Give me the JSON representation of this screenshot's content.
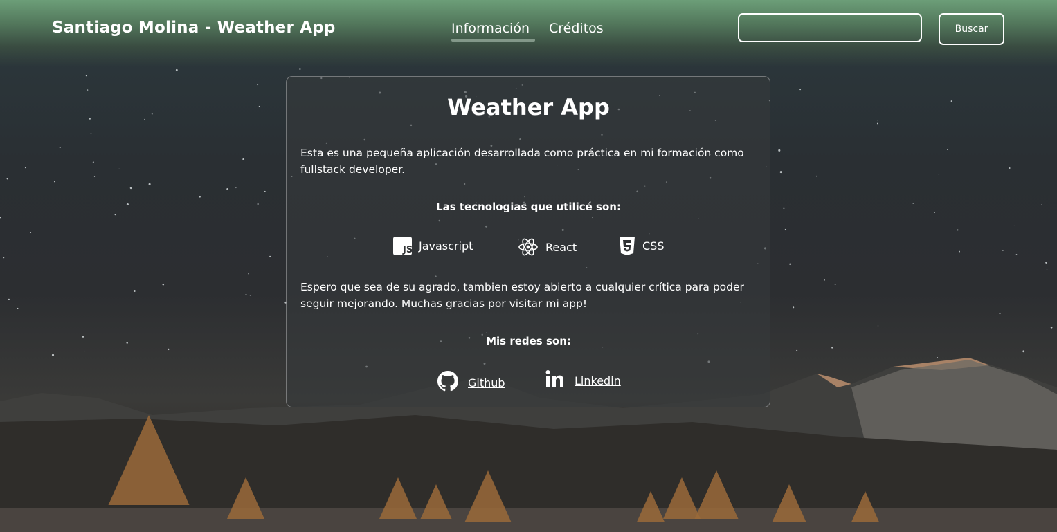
{
  "header": {
    "brand": "Santiago Molina - Weather App",
    "nav": [
      {
        "label": "Información"
      },
      {
        "label": "Créditos"
      }
    ],
    "search": {
      "value": "",
      "placeholder": "",
      "button_label": "Buscar"
    }
  },
  "card": {
    "title": "Weather App",
    "intro": "Esta es una pequeña aplicación desarrollada como práctica en mi formación como fullstack developer.",
    "tech_heading": "Las tecnologias que utilicé son:",
    "technologies": [
      {
        "label": "Javascript",
        "icon": "javascript-icon"
      },
      {
        "label": "React",
        "icon": "react-icon"
      },
      {
        "label": "CSS",
        "icon": "css3-icon"
      }
    ],
    "closing": "Espero que sea de su agrado, tambien estoy abierto a cualquier crítica para poder seguir mejorando. Muchas gracias por visitar mi app!",
    "social_heading": "Mis redes son:",
    "socials": [
      {
        "label": "Github",
        "icon": "github-icon"
      },
      {
        "label": "Linkedin",
        "icon": "linkedin-icon"
      }
    ]
  },
  "colors": {
    "navbar_green": "#6c9e78",
    "text": "#ffffff",
    "sky": "#2c3a3f"
  }
}
